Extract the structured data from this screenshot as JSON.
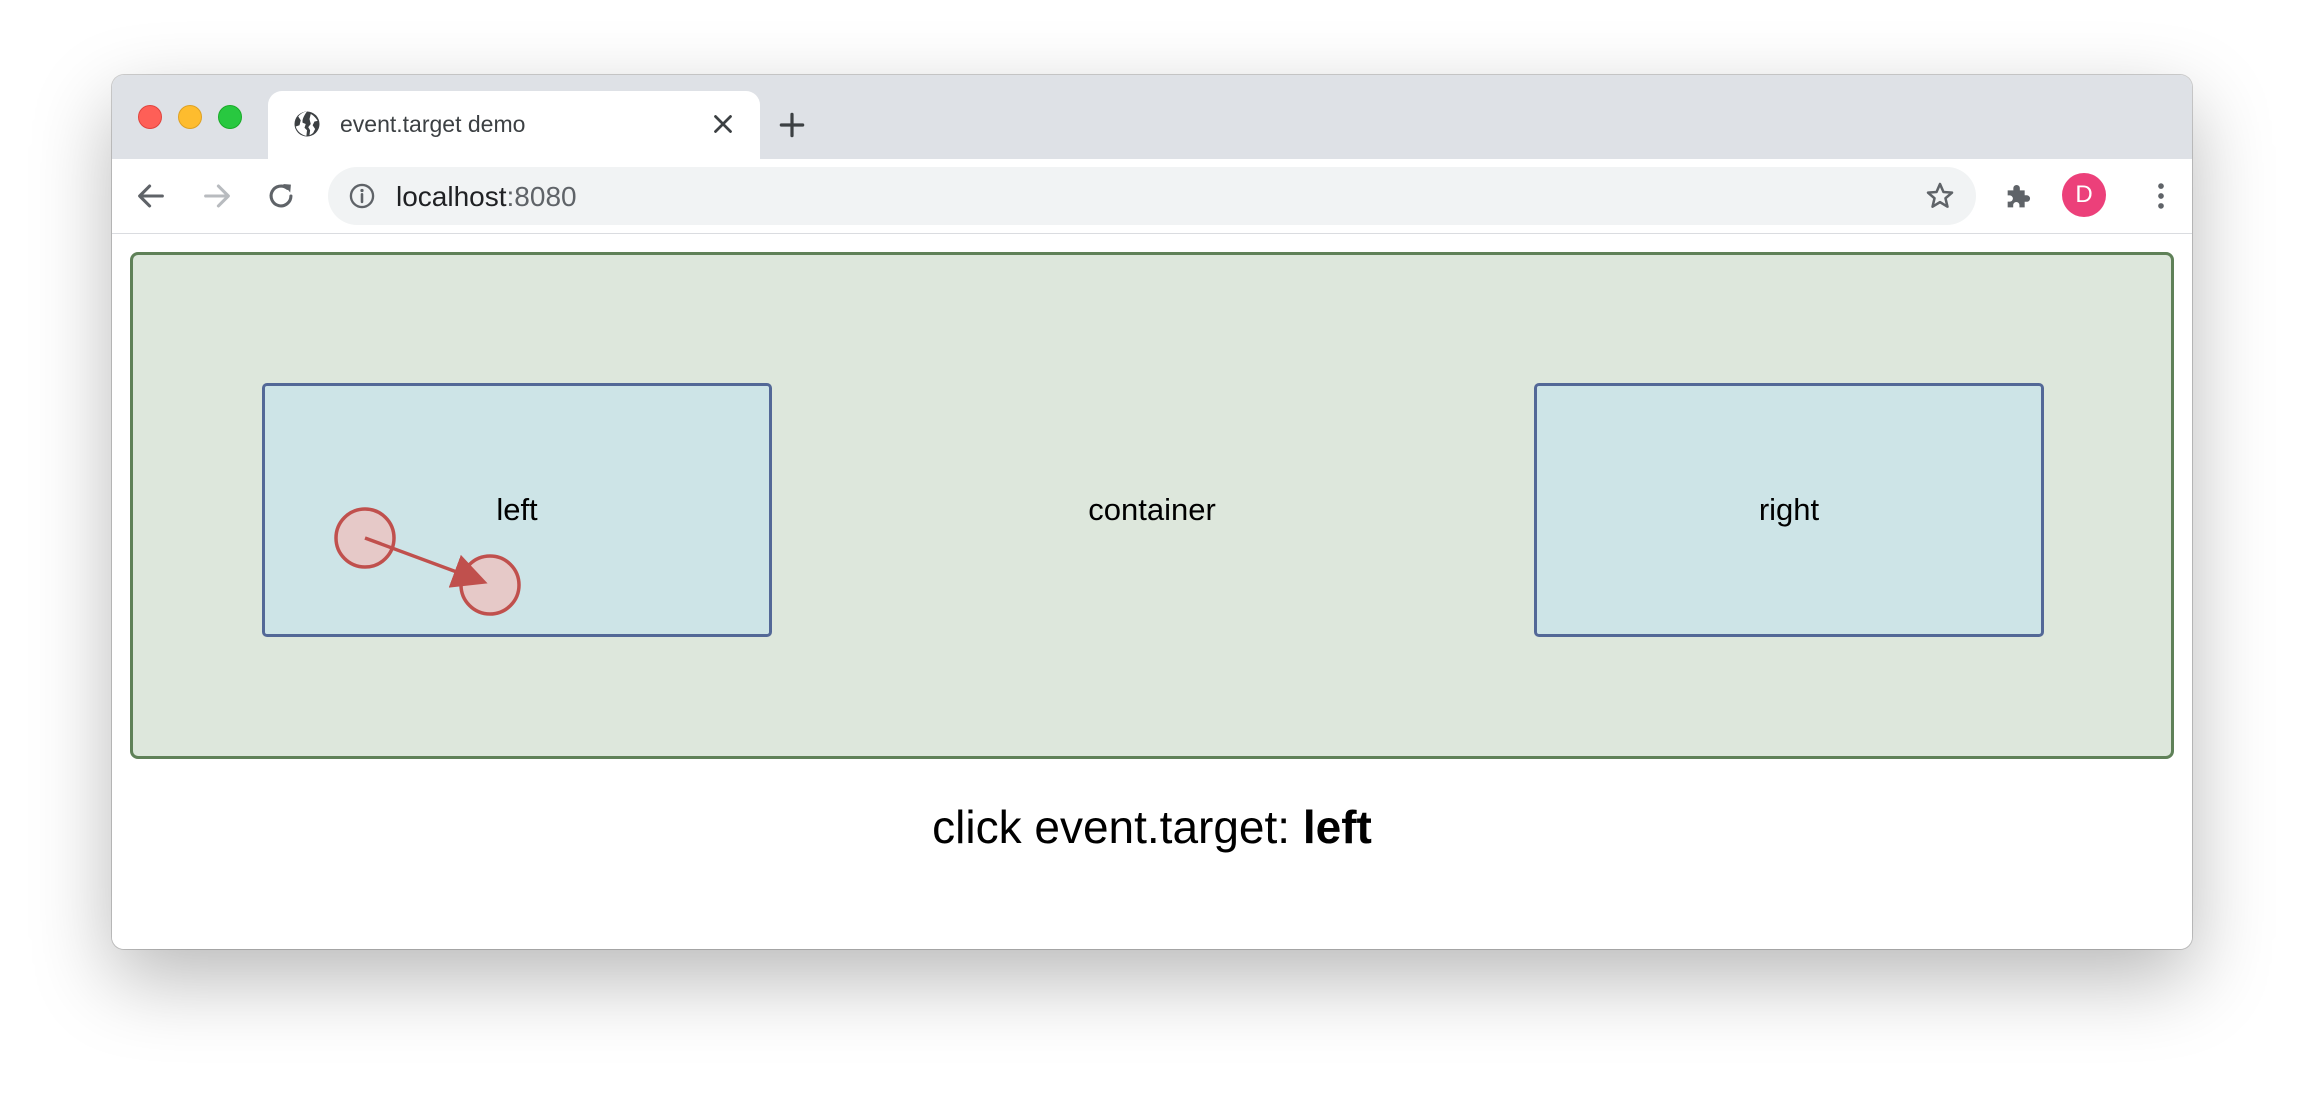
{
  "browser": {
    "tab": {
      "title": "event.target demo",
      "favicon": "globe-icon"
    },
    "address_bar": {
      "host": "localhost",
      "port": ":8080"
    },
    "avatar_letter": "D",
    "colors": {
      "tabstrip": "#dee1e6",
      "avatar": "#ec407a"
    }
  },
  "page": {
    "container_label": "container",
    "left_label": "left",
    "right_label": "right",
    "result_prefix": "click event.target: ",
    "result_value": "left",
    "colors": {
      "container_fill": "#dde7dc",
      "container_border": "#5f8158",
      "child_fill": "#cde4e7",
      "child_border": "#536897",
      "gesture": "#c0504d"
    }
  }
}
